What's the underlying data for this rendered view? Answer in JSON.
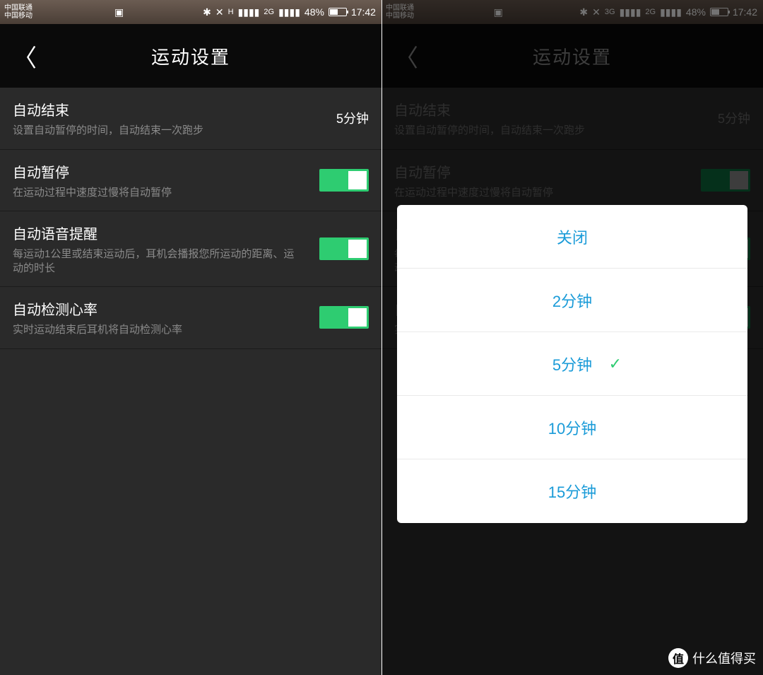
{
  "statusbar": {
    "carriers": [
      "中国联通",
      "中国移动"
    ],
    "netLeft": [
      "H",
      "3G"
    ],
    "net2g": "2G",
    "battery": "48%",
    "time": "17:42"
  },
  "header": {
    "title": "运动设置"
  },
  "rows": [
    {
      "title": "自动结束",
      "sub": "设置自动暂停的时间，自动结束一次跑步",
      "value": "5分钟"
    },
    {
      "title": "自动暂停",
      "sub": "在运动过程中速度过慢将自动暂停"
    },
    {
      "title": "自动语音提醒",
      "sub": "每运动1公里或结束运动后，耳机会播报您所运动的距离、运动的时长"
    },
    {
      "title": "自动检测心率",
      "sub": "实时运动结束后耳机将自动检测心率"
    }
  ],
  "dialog": {
    "options": [
      "关闭",
      "2分钟",
      "5分钟",
      "10分钟",
      "15分钟"
    ],
    "selectedIndex": 2
  },
  "watermark": "什么值得买",
  "watermarkIcon": "值"
}
